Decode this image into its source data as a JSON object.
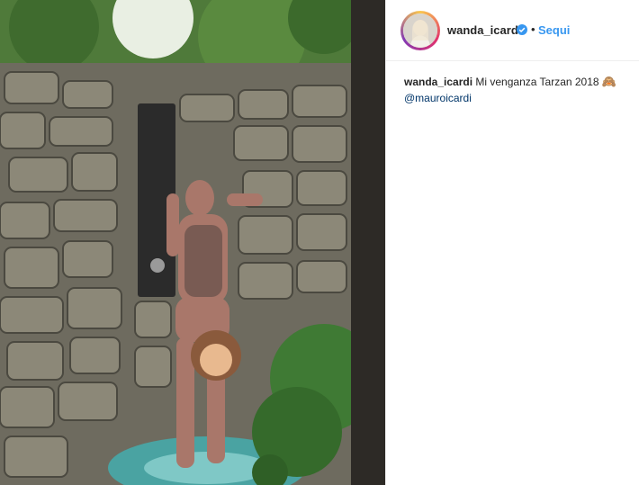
{
  "post": {
    "image_alt": "outdoor stone shower photo",
    "author": {
      "username": "wanda_icardi",
      "verified": true,
      "follow_label": "Sequi",
      "separator": "•"
    },
    "caption": {
      "username": "wanda_icardi",
      "text": "Mi venganza Tarzan 2018",
      "emoji": "🙈",
      "mention": "@mauroicardi"
    }
  },
  "colors": {
    "follow": "#3897f0",
    "verified": "#3897f0",
    "text": "#262626",
    "mention": "#003569"
  }
}
